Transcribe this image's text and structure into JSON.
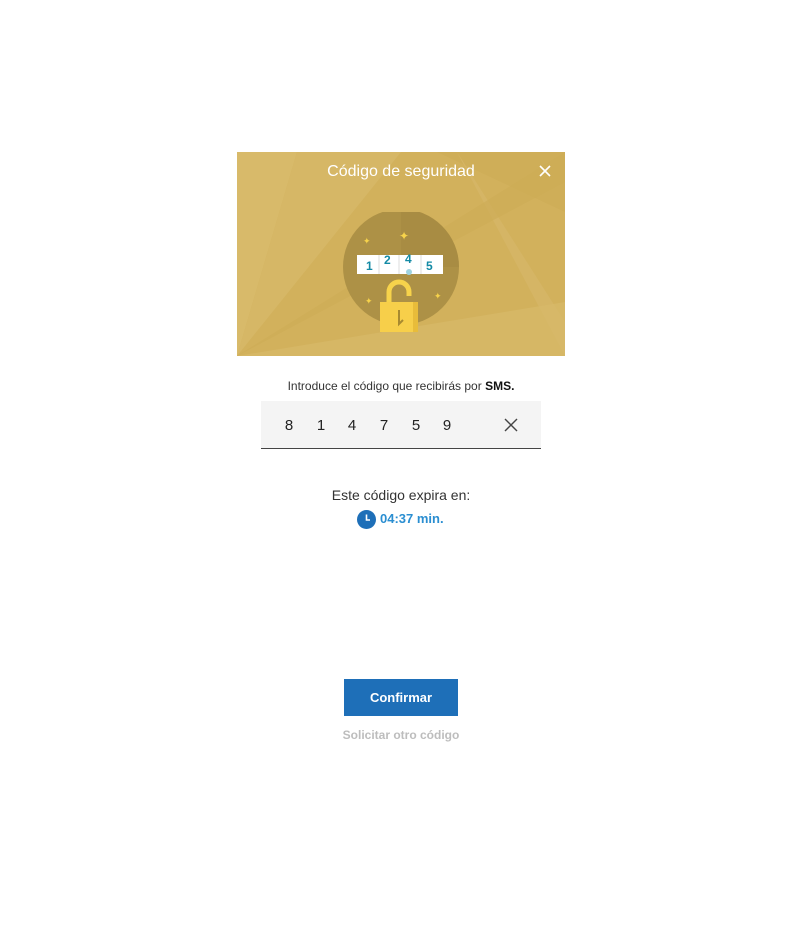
{
  "dialog": {
    "title": "Código de seguridad",
    "close_icon": "close-icon",
    "illustration": {
      "icon": "padlock-code-illustration",
      "code_digits": [
        "1",
        "2",
        "4",
        "5"
      ]
    },
    "colors": {
      "header": "#d2b15c",
      "accent": "#1e6fb8",
      "timer": "#2a8ed1"
    }
  },
  "instruction": {
    "text": "Introduce el código que recibirás por",
    "emphasis": "SMS."
  },
  "code_input": {
    "digits": [
      "8",
      "1",
      "4",
      "7",
      "5",
      "9"
    ],
    "clear_icon": "clear-icon"
  },
  "expiry": {
    "label": "Este código expira en:",
    "time": "04:37 min.",
    "icon": "clock-icon"
  },
  "actions": {
    "confirm_label": "Confirmar",
    "resend_label": "Solicitar otro código"
  }
}
